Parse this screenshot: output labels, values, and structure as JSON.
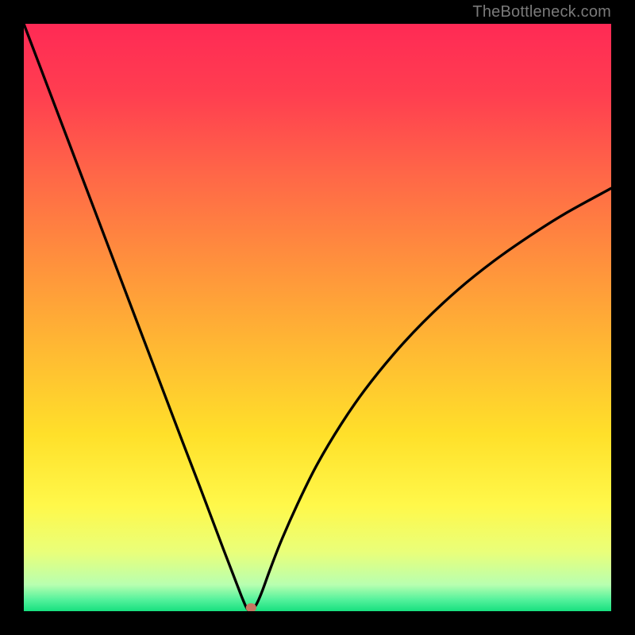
{
  "watermark": "TheBottleneck.com",
  "chart_data": {
    "type": "line",
    "title": "",
    "xlabel": "",
    "ylabel": "",
    "xlim": [
      0,
      100
    ],
    "ylim": [
      0,
      100
    ],
    "background_gradient_stops": [
      {
        "offset": 0.0,
        "color": "#ff2a55"
      },
      {
        "offset": 0.12,
        "color": "#ff3e50"
      },
      {
        "offset": 0.25,
        "color": "#ff6548"
      },
      {
        "offset": 0.4,
        "color": "#ff8f3d"
      },
      {
        "offset": 0.55,
        "color": "#ffb833"
      },
      {
        "offset": 0.7,
        "color": "#ffe02a"
      },
      {
        "offset": 0.82,
        "color": "#fff84a"
      },
      {
        "offset": 0.9,
        "color": "#e9ff7a"
      },
      {
        "offset": 0.955,
        "color": "#b8ffb0"
      },
      {
        "offset": 0.98,
        "color": "#56f29c"
      },
      {
        "offset": 1.0,
        "color": "#17e07f"
      }
    ],
    "curve": {
      "x": [
        0,
        3,
        6,
        9,
        12,
        15,
        18,
        21,
        24,
        27,
        30,
        32,
        34,
        35.5,
        36.5,
        37.2,
        37.8,
        38.2,
        38.5,
        39.5,
        40.5,
        42,
        44,
        47,
        50,
        54,
        58,
        63,
        68,
        74,
        80,
        86,
        92,
        100
      ],
      "y": [
        100,
        92.1,
        84.2,
        76.3,
        68.4,
        60.5,
        52.6,
        44.7,
        36.8,
        28.9,
        21.1,
        15.8,
        10.5,
        6.6,
        4.0,
        2.2,
        0.8,
        0.2,
        0.0,
        1.0,
        3.2,
        7.3,
        12.4,
        19.1,
        25.1,
        31.8,
        37.6,
        43.8,
        49.2,
        54.8,
        59.6,
        63.8,
        67.6,
        72.0
      ]
    },
    "marker": {
      "x": 38.7,
      "y": 0.6,
      "color": "#c77762",
      "rx": 0.9,
      "ry": 0.75
    }
  }
}
